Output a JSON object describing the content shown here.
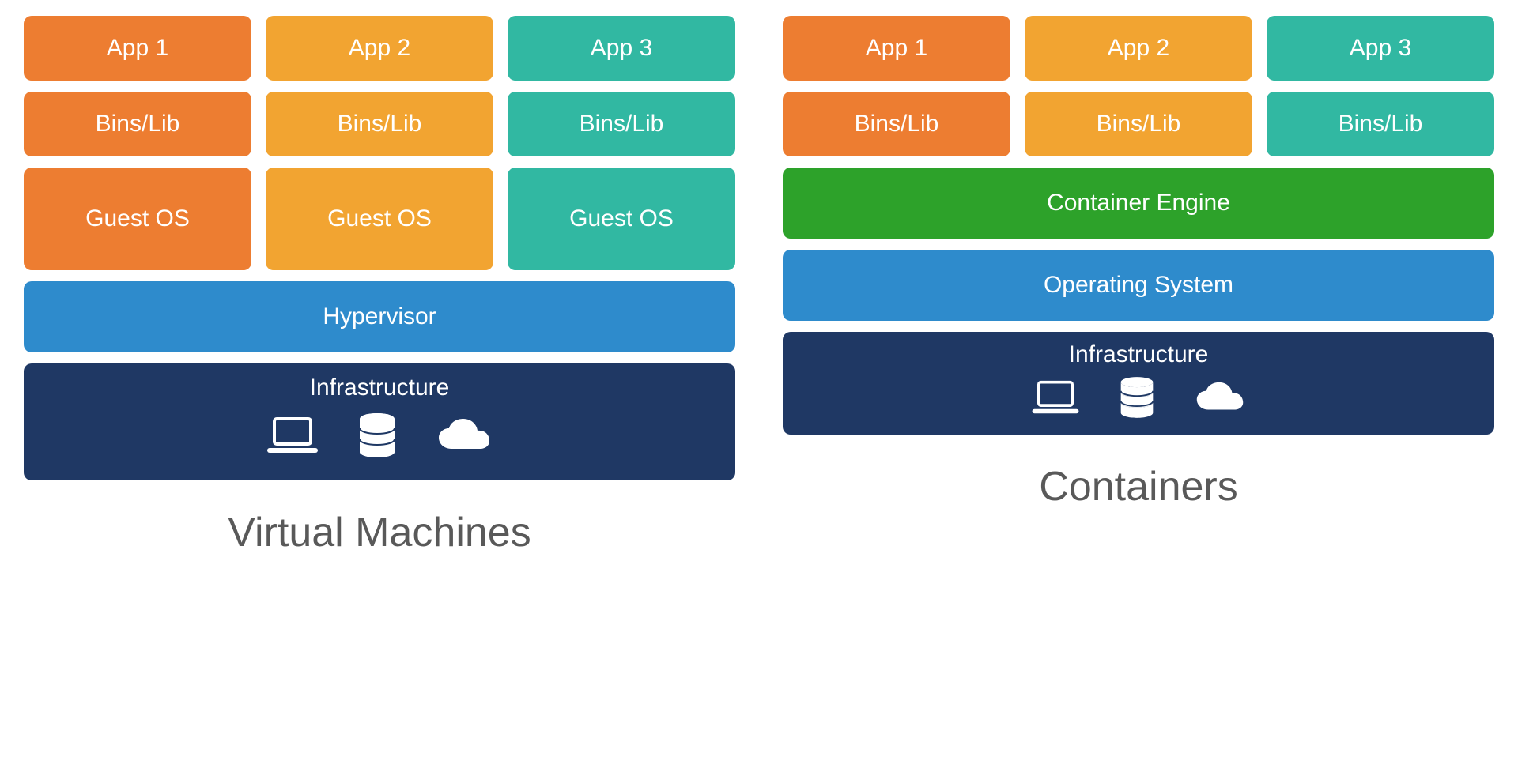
{
  "colors": {
    "orange": "#ED7D31",
    "amber": "#F2A431",
    "teal": "#31B8A2",
    "blue": "#2E8BCC",
    "navy": "#1F3864",
    "green": "#2DA22A",
    "titleGray": "#595959"
  },
  "vm": {
    "title": "Virtual Machines",
    "apps": [
      "App 1",
      "App 2",
      "App 3"
    ],
    "bins": [
      "Bins/Lib",
      "Bins/Lib",
      "Bins/Lib"
    ],
    "guestos": [
      "Guest OS",
      "Guest OS",
      "Guest OS"
    ],
    "hypervisor": "Hypervisor",
    "infrastructure": "Infrastructure"
  },
  "containers": {
    "title": "Containers",
    "apps": [
      "App 1",
      "App 2",
      "App 3"
    ],
    "bins": [
      "Bins/Lib",
      "Bins/Lib",
      "Bins/Lib"
    ],
    "engine": "Container Engine",
    "os": "Operating System",
    "infrastructure": "Infrastructure"
  }
}
